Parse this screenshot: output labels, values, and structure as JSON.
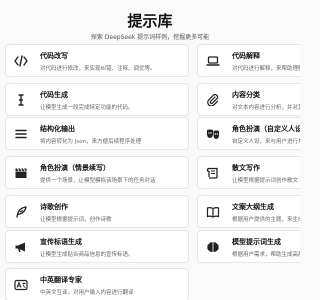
{
  "header": {
    "title": "提示库",
    "subtitle": "探索 DeepSeek 提示词样例，挖掘更多可能"
  },
  "cards": [
    {
      "title": "代码改写",
      "desc": "对代码进行修改，来实现纠错、注释、调优等。",
      "icon": "code-icon"
    },
    {
      "title": "代码解释",
      "desc": "对代码进行解释，来帮助理解代码内容。",
      "icon": "laptop-icon"
    },
    {
      "title": "代码生成",
      "desc": "让模型生成一段完成特定功能的代码。",
      "icon": "text-cursor-icon"
    },
    {
      "title": "内容分类",
      "desc": "对文本内容进行分析，并对其进行自动归类",
      "icon": "paperclip-icon"
    },
    {
      "title": "结构化输出",
      "desc": "将内容转化为 Json，来方便后续程序处理",
      "icon": "list-icon"
    },
    {
      "title": "角色扮演（自定义人设）",
      "desc": "自定义人设，来与用户进行角色扮演。",
      "icon": "theater-masks-icon"
    },
    {
      "title": "角色扮演（情景续写）",
      "desc": "提供一个场景，让模型模拟该场景下的任务对话",
      "icon": "clapperboard-icon"
    },
    {
      "title": "散文写作",
      "desc": "让模型根据提示词创作散文",
      "icon": "scroll-icon"
    },
    {
      "title": "诗歌创作",
      "desc": "让模型根据提示词，创作诗歌",
      "icon": "feather-icon"
    },
    {
      "title": "文案大纲生成",
      "desc": "根据用户提供的主题，来生成文案大纲",
      "icon": "book-icon"
    },
    {
      "title": "宣传标语生成",
      "desc": "让模型生成贴合商品信息的宣传标语。",
      "icon": "megaphone-icon"
    },
    {
      "title": "模型提示词生成",
      "desc": "根据用户需求，帮助生成高质量提示词",
      "icon": "brain-icon"
    },
    {
      "title": "中英翻译专家",
      "desc": "中英文互译，对用户输入内容进行翻译",
      "icon": "translate-icon"
    }
  ]
}
